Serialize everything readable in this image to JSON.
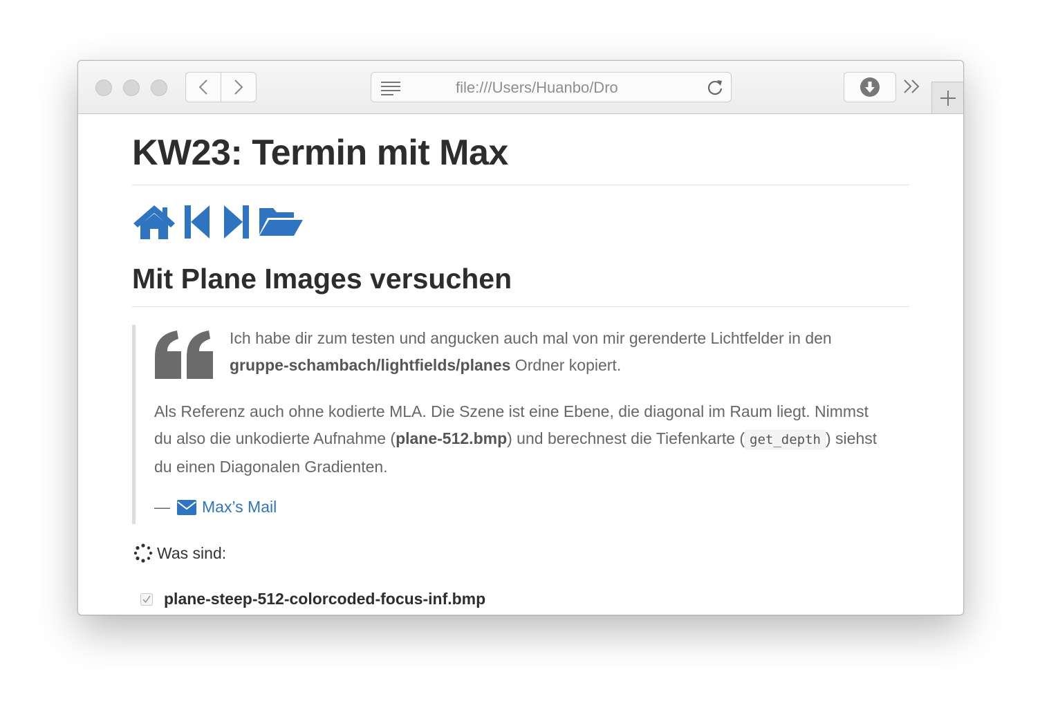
{
  "browser": {
    "url": "file:///Users/Huanbo/Dro",
    "accent_color": "#2f74c0"
  },
  "page": {
    "title": "KW23: Termin mit Max",
    "nav_icons": [
      "home-icon",
      "step-backward-icon",
      "step-forward-icon",
      "folder-open-icon"
    ],
    "section_title": "Mit Plane Images versuchen",
    "quote": {
      "p1_text": "Ich habe dir zum testen und angucken auch mal von mir gerenderte Lichtfelder in den ",
      "p1_bold": "gruppe-schambach/lightfields/planes",
      "p1_tail": " Ordner kopiert.",
      "p2_text": "Als Referenz auch ohne kodierte MLA. Die Szene ist eine Ebene, die diagonal im Raum liegt. Nimmst du also die unkodierte Aufnahme (",
      "p2_bold": "plane-512.bmp",
      "p2_mid": ") und berechnest die Tiefenkarte (",
      "p2_code": "get_depth",
      "p2_tail": ") siehst du einen Diagonalen Gradienten.",
      "attribution_dash": "—",
      "attribution_link": "Max’s Mail"
    },
    "question_label": "Was sind:",
    "task_items": [
      {
        "label": "plane-steep-512-colorcoded-focus-inf.bmp",
        "checked": true
      }
    ]
  }
}
